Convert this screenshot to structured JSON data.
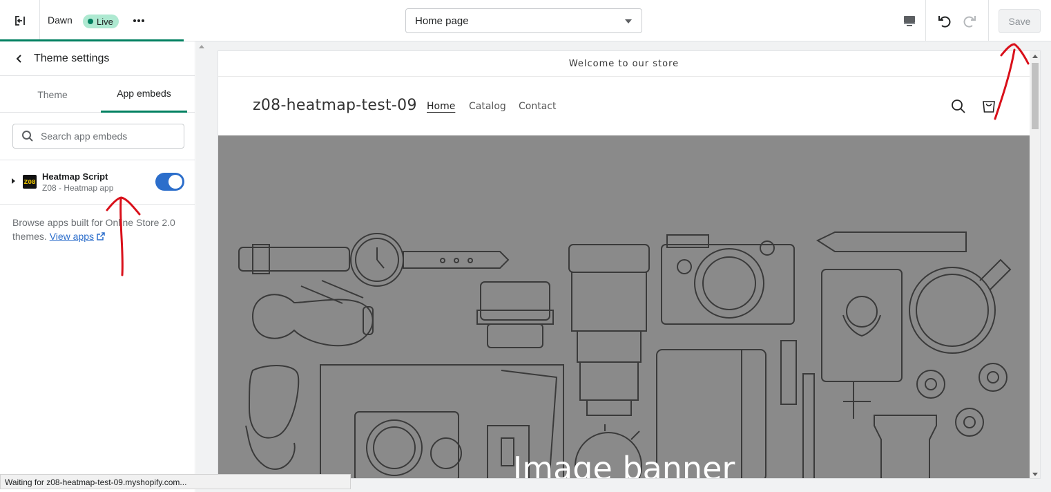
{
  "topbar": {
    "exit_icon": "exit-icon",
    "theme_name": "Dawn",
    "status_badge": "Live",
    "more_icon": "more-horizontal-icon",
    "page_selector": {
      "value": "Home page",
      "icon": "chevron-down-icon"
    },
    "device_icon": "desktop-icon",
    "undo_icon": "undo-icon",
    "redo_icon": "redo-icon",
    "save_label": "Save"
  },
  "sidebar": {
    "back_icon": "chevron-left-icon",
    "title": "Theme settings",
    "tabs": [
      {
        "label": "Theme",
        "active": false
      },
      {
        "label": "App embeds",
        "active": true
      }
    ],
    "search": {
      "placeholder": "Search app embeds",
      "icon": "search-icon"
    },
    "embeds": [
      {
        "logo_text": "Z08",
        "name": "Heatmap Script",
        "app": "Z08 - Heatmap app",
        "enabled": true
      }
    ],
    "browse": {
      "text": "Browse apps built for Online Store 2.0 themes.",
      "link_label": "View apps",
      "link_icon": "external-link-icon"
    }
  },
  "preview": {
    "announcement": "Welcome to our store",
    "store_name": "z08-heatmap-test-09",
    "nav": [
      "Home",
      "Catalog",
      "Contact"
    ],
    "header_icons": [
      "search-icon",
      "cart-icon"
    ],
    "banner_title": "Image banner"
  },
  "browser_status": "Waiting for z08-heatmap-test-09.myshopify.com...",
  "colors": {
    "accent": "#008060",
    "toggle_on": "#2c6ecb",
    "live_badge": "#aee9d1",
    "banner_bg": "#8a8a8a",
    "annotation": "#d9101a"
  }
}
